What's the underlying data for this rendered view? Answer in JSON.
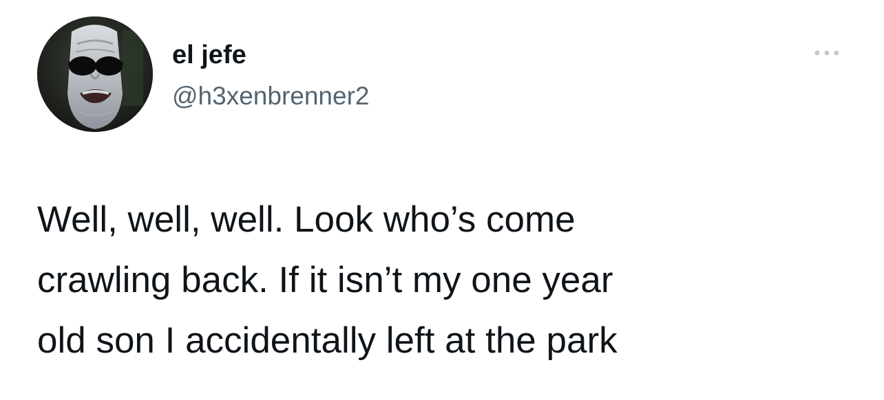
{
  "tweet": {
    "author": {
      "display_name": "el jefe",
      "handle": "@h3xenbrenner2",
      "avatar_icon": "profile-photo-pale-face-sunglasses"
    },
    "more_icon": "more-horizontal-icon",
    "text": "Well, well, well. Look who’s come\ncrawling back. If it isn’t my one year\nold son I accidentally left at the park"
  },
  "colors": {
    "background": "#ffffff",
    "primary_text": "#0f1419",
    "secondary_text": "#536471",
    "more_icon": "#c4cacf"
  }
}
